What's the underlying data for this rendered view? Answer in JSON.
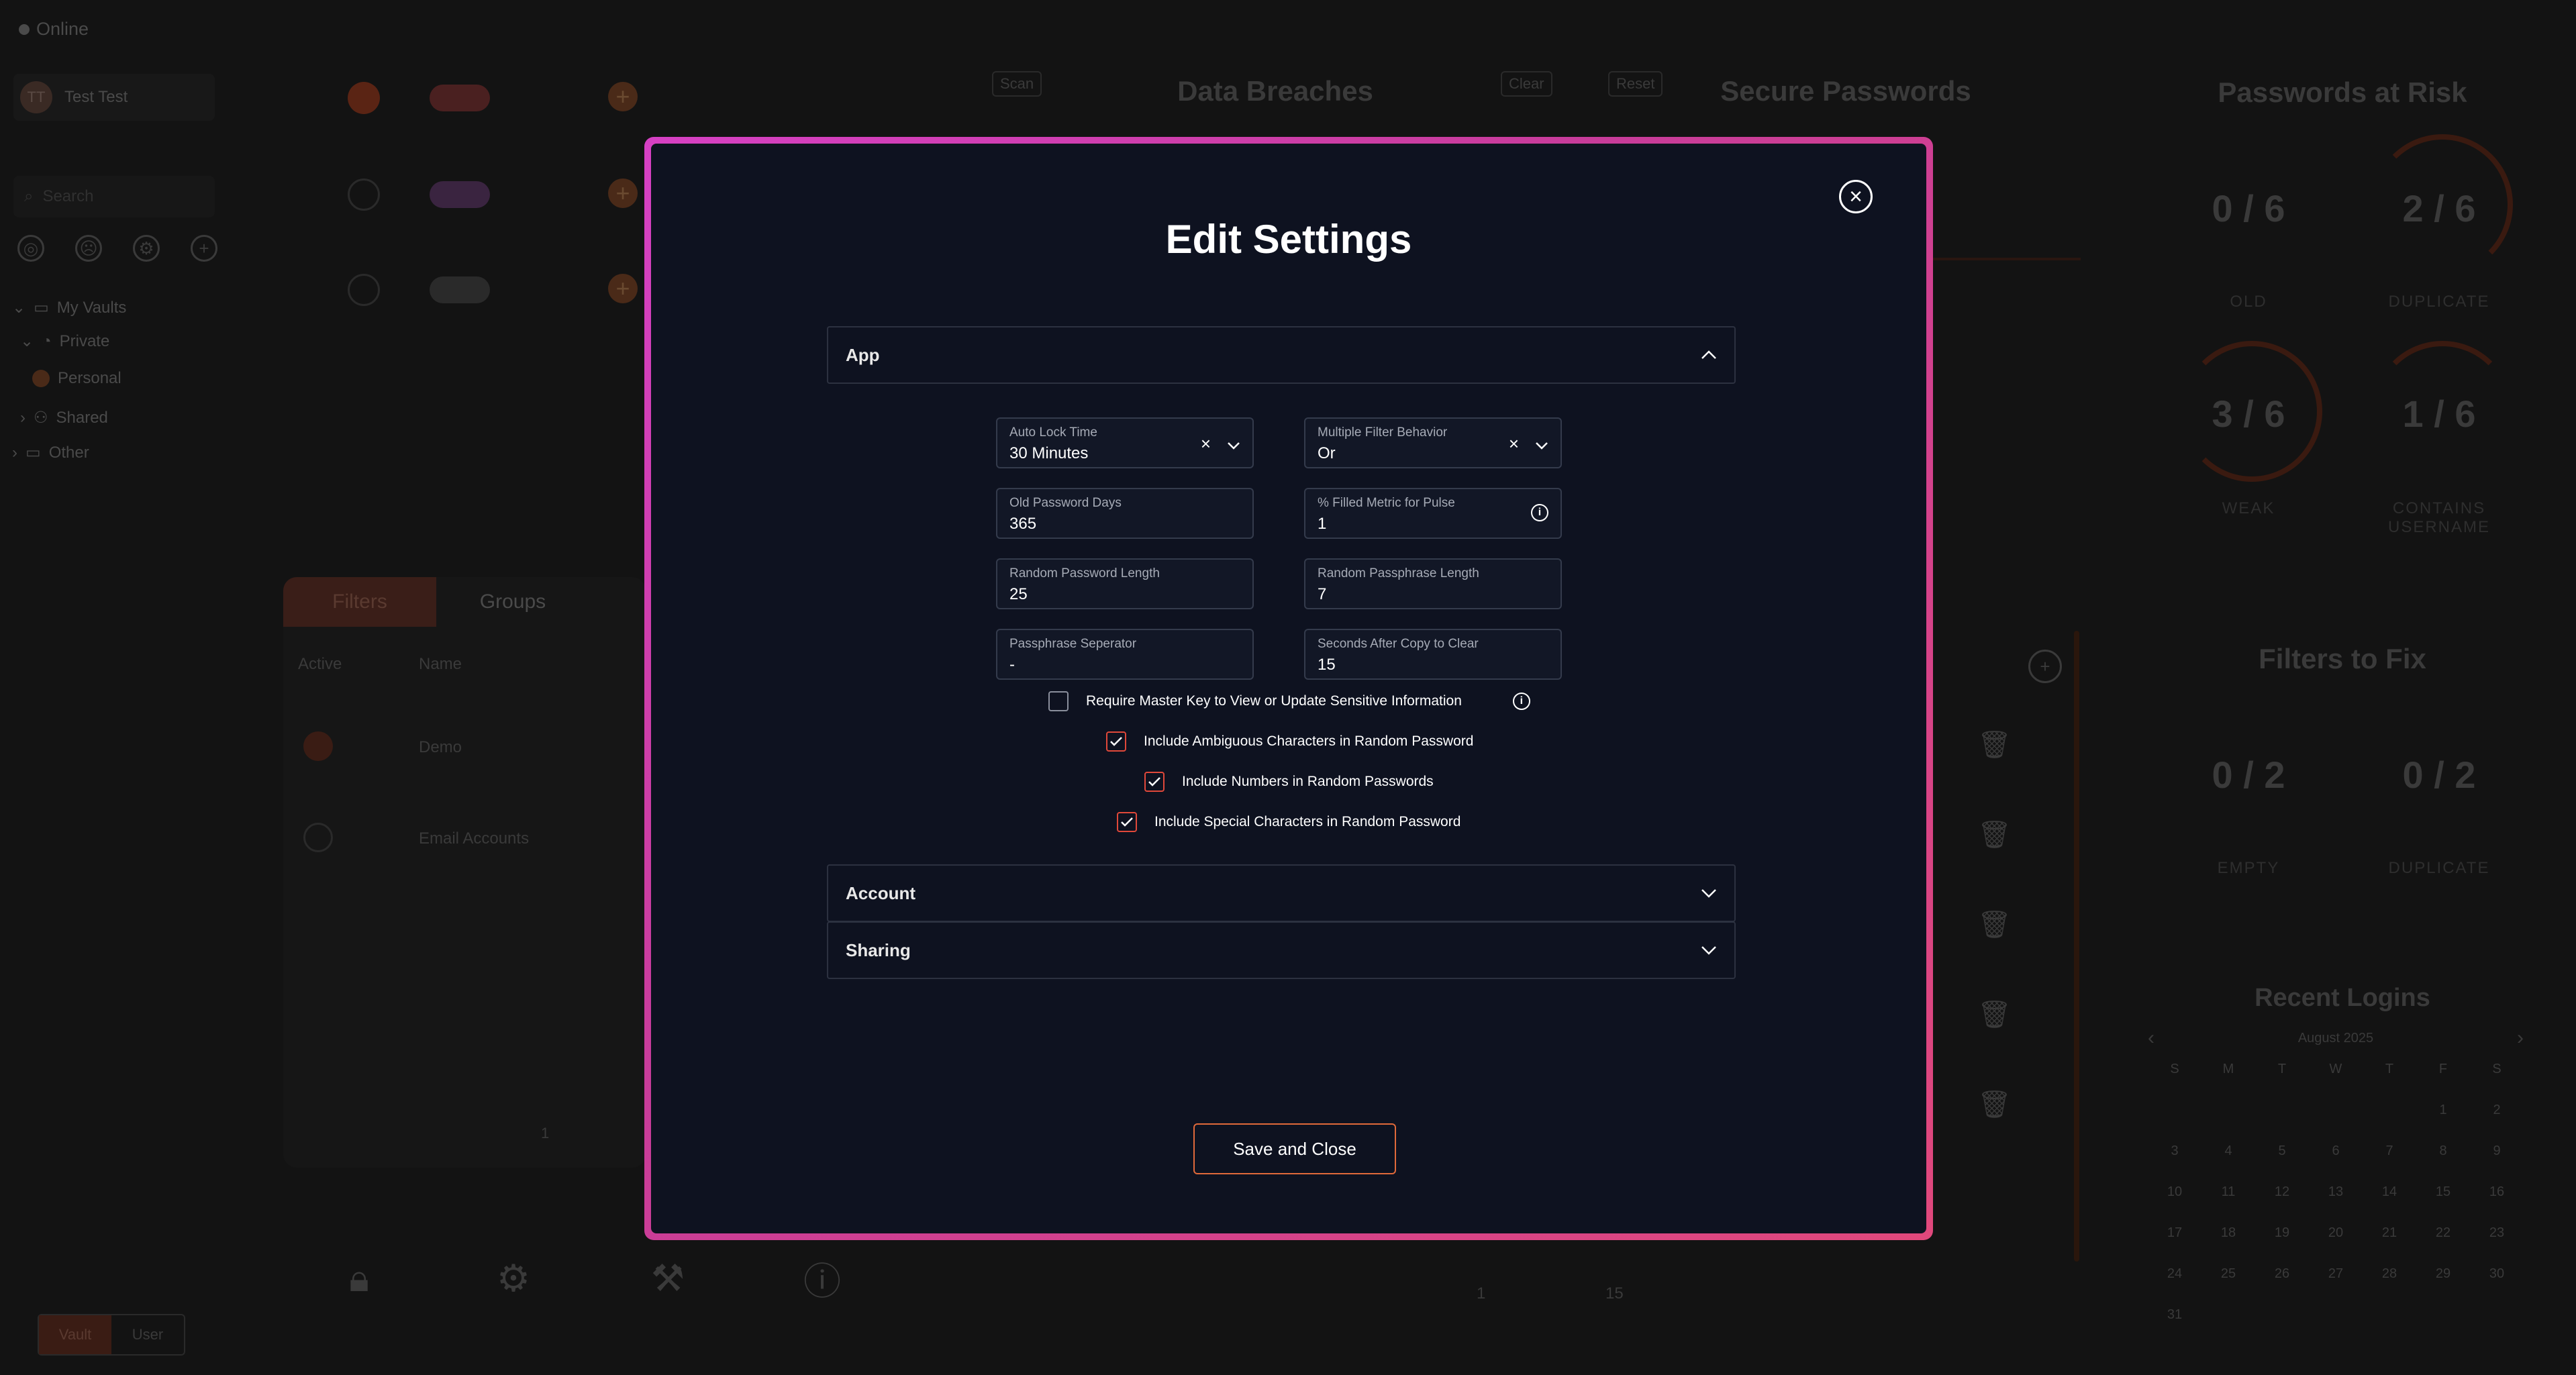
{
  "background": {
    "status": "Online",
    "user_name": "Test Test",
    "user_initials": "TT",
    "search_placeholder": "Search",
    "tree": {
      "my_vaults": "My Vaults",
      "private": "Private",
      "personal": "Personal",
      "shared": "Shared",
      "other": "Other"
    },
    "tabs": {
      "filters": "Filters",
      "groups": "Groups"
    },
    "table": {
      "col_active": "Active",
      "col_name": "Name",
      "rows": [
        "Demo",
        "Email Accounts"
      ]
    },
    "pager_current": "1",
    "bottom_toggle": {
      "vault": "Vault",
      "user": "User"
    },
    "breaches": {
      "title": "Data Breaches",
      "scan": "Scan",
      "clear": "Clear"
    },
    "secure": {
      "title": "Secure Passwords",
      "reset": "Reset"
    },
    "pager_mid": {
      "current": "1",
      "page_size": "15"
    },
    "at_risk": {
      "title": "Passwords at Risk",
      "items": [
        {
          "value": "0 / 6",
          "label": "OLD"
        },
        {
          "value": "2 / 6",
          "label": "DUPLICATE"
        },
        {
          "value": "3 / 6",
          "label": "WEAK"
        },
        {
          "value": "1 / 6",
          "label": "CONTAINS USERNAME"
        }
      ]
    },
    "filters_fix": {
      "title": "Filters to Fix",
      "items": [
        {
          "value": "0 / 2",
          "label": "EMPTY"
        },
        {
          "value": "0 / 2",
          "label": "DUPLICATE"
        }
      ]
    },
    "recent_logins": {
      "title": "Recent Logins",
      "month": "August 2025",
      "weekdays": [
        "S",
        "M",
        "T",
        "W",
        "T",
        "F",
        "S"
      ],
      "days": [
        "",
        "",
        "",
        "",
        "",
        "1",
        "2",
        "3",
        "4",
        "5",
        "6",
        "7",
        "8",
        "9",
        "10",
        "11",
        "12",
        "13",
        "14",
        "15",
        "16",
        "17",
        "18",
        "19",
        "20",
        "21",
        "22",
        "23",
        "24",
        "25",
        "26",
        "27",
        "28",
        "29",
        "30",
        "31"
      ]
    }
  },
  "modal": {
    "title": "Edit Settings",
    "sections": {
      "app": "App",
      "account": "Account",
      "sharing": "Sharing"
    },
    "fields": {
      "auto_lock_label": "Auto Lock Time",
      "auto_lock_value": "30 Minutes",
      "filter_behavior_label": "Multiple Filter Behavior",
      "filter_behavior_value": "Or",
      "old_pw_days_label": "Old Password Days",
      "old_pw_days_value": "365",
      "filled_metric_label": "% Filled Metric for Pulse",
      "filled_metric_value": "1",
      "rand_pw_len_label": "Random Password Length",
      "rand_pw_len_value": "25",
      "rand_pp_len_label": "Random Passphrase Length",
      "rand_pp_len_value": "7",
      "pp_sep_label": "Passphrase Seperator",
      "pp_sep_value": "-",
      "copy_clear_label": "Seconds After Copy to Clear",
      "copy_clear_value": "15"
    },
    "checkboxes": {
      "master_key": "Require Master Key to View or Update Sensitive Information",
      "ambiguous": "Include Ambiguous Characters in Random Password",
      "numbers": "Include Numbers in Random Passwords",
      "special": "Include Special Characters in Random Password"
    },
    "save_label": "Save and Close"
  }
}
